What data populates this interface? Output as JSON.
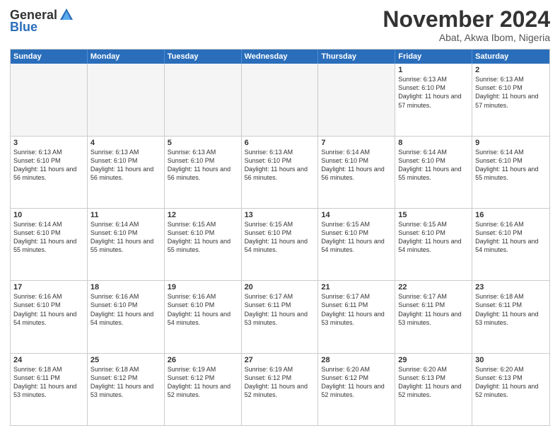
{
  "logo": {
    "general": "General",
    "blue": "Blue"
  },
  "title": "November 2024",
  "subtitle": "Abat, Akwa Ibom, Nigeria",
  "header_days": [
    "Sunday",
    "Monday",
    "Tuesday",
    "Wednesday",
    "Thursday",
    "Friday",
    "Saturday"
  ],
  "weeks": [
    [
      {
        "day": "",
        "info": "",
        "empty": true
      },
      {
        "day": "",
        "info": "",
        "empty": true
      },
      {
        "day": "",
        "info": "",
        "empty": true
      },
      {
        "day": "",
        "info": "",
        "empty": true
      },
      {
        "day": "",
        "info": "",
        "empty": true
      },
      {
        "day": "1",
        "info": "Sunrise: 6:13 AM\nSunset: 6:10 PM\nDaylight: 11 hours and 57 minutes.",
        "empty": false
      },
      {
        "day": "2",
        "info": "Sunrise: 6:13 AM\nSunset: 6:10 PM\nDaylight: 11 hours and 57 minutes.",
        "empty": false
      }
    ],
    [
      {
        "day": "3",
        "info": "Sunrise: 6:13 AM\nSunset: 6:10 PM\nDaylight: 11 hours and 56 minutes.",
        "empty": false
      },
      {
        "day": "4",
        "info": "Sunrise: 6:13 AM\nSunset: 6:10 PM\nDaylight: 11 hours and 56 minutes.",
        "empty": false
      },
      {
        "day": "5",
        "info": "Sunrise: 6:13 AM\nSunset: 6:10 PM\nDaylight: 11 hours and 56 minutes.",
        "empty": false
      },
      {
        "day": "6",
        "info": "Sunrise: 6:13 AM\nSunset: 6:10 PM\nDaylight: 11 hours and 56 minutes.",
        "empty": false
      },
      {
        "day": "7",
        "info": "Sunrise: 6:14 AM\nSunset: 6:10 PM\nDaylight: 11 hours and 56 minutes.",
        "empty": false
      },
      {
        "day": "8",
        "info": "Sunrise: 6:14 AM\nSunset: 6:10 PM\nDaylight: 11 hours and 55 minutes.",
        "empty": false
      },
      {
        "day": "9",
        "info": "Sunrise: 6:14 AM\nSunset: 6:10 PM\nDaylight: 11 hours and 55 minutes.",
        "empty": false
      }
    ],
    [
      {
        "day": "10",
        "info": "Sunrise: 6:14 AM\nSunset: 6:10 PM\nDaylight: 11 hours and 55 minutes.",
        "empty": false
      },
      {
        "day": "11",
        "info": "Sunrise: 6:14 AM\nSunset: 6:10 PM\nDaylight: 11 hours and 55 minutes.",
        "empty": false
      },
      {
        "day": "12",
        "info": "Sunrise: 6:15 AM\nSunset: 6:10 PM\nDaylight: 11 hours and 55 minutes.",
        "empty": false
      },
      {
        "day": "13",
        "info": "Sunrise: 6:15 AM\nSunset: 6:10 PM\nDaylight: 11 hours and 54 minutes.",
        "empty": false
      },
      {
        "day": "14",
        "info": "Sunrise: 6:15 AM\nSunset: 6:10 PM\nDaylight: 11 hours and 54 minutes.",
        "empty": false
      },
      {
        "day": "15",
        "info": "Sunrise: 6:15 AM\nSunset: 6:10 PM\nDaylight: 11 hours and 54 minutes.",
        "empty": false
      },
      {
        "day": "16",
        "info": "Sunrise: 6:16 AM\nSunset: 6:10 PM\nDaylight: 11 hours and 54 minutes.",
        "empty": false
      }
    ],
    [
      {
        "day": "17",
        "info": "Sunrise: 6:16 AM\nSunset: 6:10 PM\nDaylight: 11 hours and 54 minutes.",
        "empty": false
      },
      {
        "day": "18",
        "info": "Sunrise: 6:16 AM\nSunset: 6:10 PM\nDaylight: 11 hours and 54 minutes.",
        "empty": false
      },
      {
        "day": "19",
        "info": "Sunrise: 6:16 AM\nSunset: 6:10 PM\nDaylight: 11 hours and 54 minutes.",
        "empty": false
      },
      {
        "day": "20",
        "info": "Sunrise: 6:17 AM\nSunset: 6:11 PM\nDaylight: 11 hours and 53 minutes.",
        "empty": false
      },
      {
        "day": "21",
        "info": "Sunrise: 6:17 AM\nSunset: 6:11 PM\nDaylight: 11 hours and 53 minutes.",
        "empty": false
      },
      {
        "day": "22",
        "info": "Sunrise: 6:17 AM\nSunset: 6:11 PM\nDaylight: 11 hours and 53 minutes.",
        "empty": false
      },
      {
        "day": "23",
        "info": "Sunrise: 6:18 AM\nSunset: 6:11 PM\nDaylight: 11 hours and 53 minutes.",
        "empty": false
      }
    ],
    [
      {
        "day": "24",
        "info": "Sunrise: 6:18 AM\nSunset: 6:11 PM\nDaylight: 11 hours and 53 minutes.",
        "empty": false
      },
      {
        "day": "25",
        "info": "Sunrise: 6:18 AM\nSunset: 6:12 PM\nDaylight: 11 hours and 53 minutes.",
        "empty": false
      },
      {
        "day": "26",
        "info": "Sunrise: 6:19 AM\nSunset: 6:12 PM\nDaylight: 11 hours and 52 minutes.",
        "empty": false
      },
      {
        "day": "27",
        "info": "Sunrise: 6:19 AM\nSunset: 6:12 PM\nDaylight: 11 hours and 52 minutes.",
        "empty": false
      },
      {
        "day": "28",
        "info": "Sunrise: 6:20 AM\nSunset: 6:12 PM\nDaylight: 11 hours and 52 minutes.",
        "empty": false
      },
      {
        "day": "29",
        "info": "Sunrise: 6:20 AM\nSunset: 6:13 PM\nDaylight: 11 hours and 52 minutes.",
        "empty": false
      },
      {
        "day": "30",
        "info": "Sunrise: 6:20 AM\nSunset: 6:13 PM\nDaylight: 11 hours and 52 minutes.",
        "empty": false
      }
    ]
  ]
}
